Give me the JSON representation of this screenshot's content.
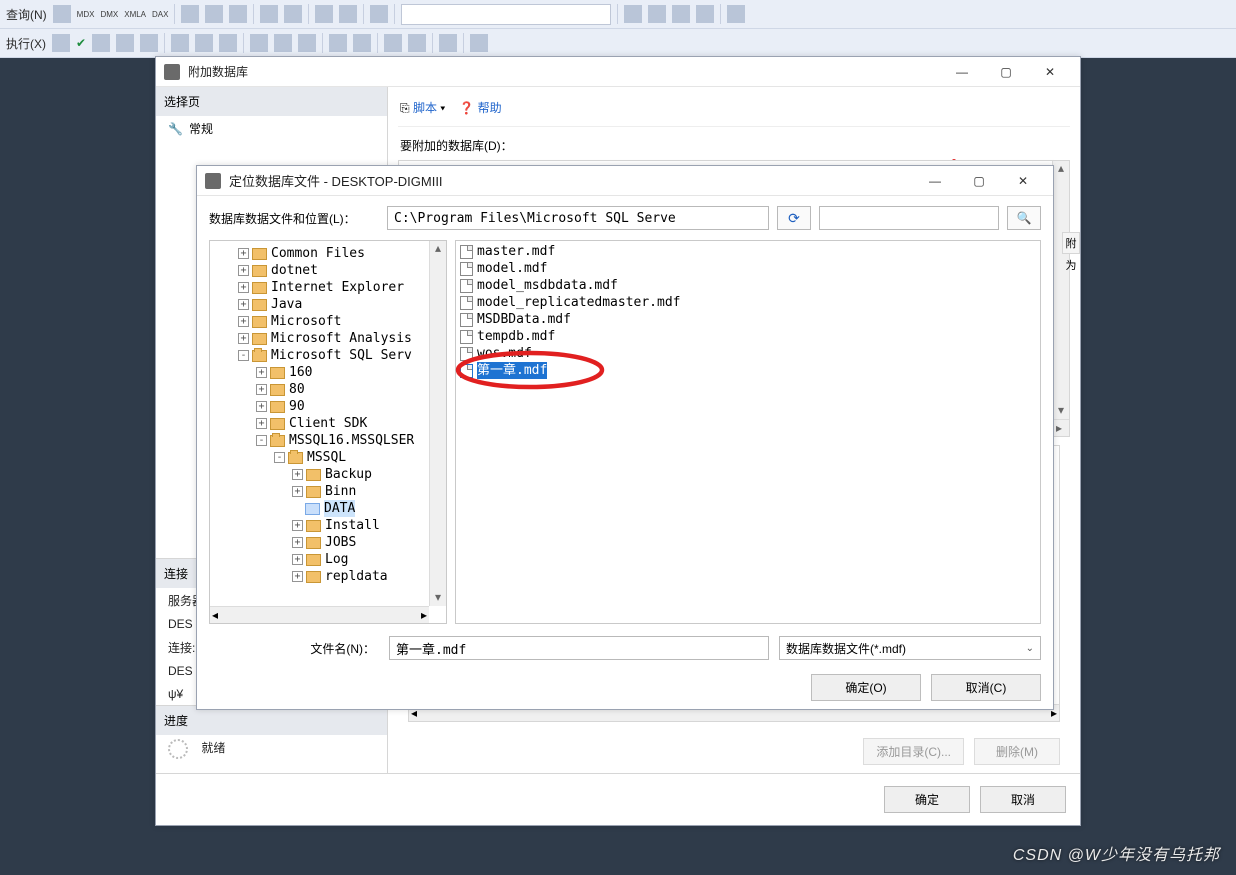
{
  "toolbar": {
    "query_label": "查询(N)",
    "mdx": "MDX",
    "dmx": "DMX",
    "xmla": "XMLA",
    "dax": "DAX",
    "run_label": "执行(X)"
  },
  "attach_dialog": {
    "title": "附加数据库",
    "left": {
      "select_page": "选择页",
      "general": "常规",
      "connection": "连接",
      "server_label": "服务器:",
      "server_value": "DES",
      "conn_label": "连接:",
      "conn_value": "DES",
      "progress": "进度",
      "status": "就绪"
    },
    "right": {
      "script": "脚本",
      "help": "帮助",
      "attach_db_label": "要附加的数据库(D)：",
      "add_dir": "添加目录(C)...",
      "delete_btn": "删除(M)",
      "detail_title_partial": "附为"
    },
    "footer": {
      "ok": "确定",
      "cancel": "取消"
    }
  },
  "locate_dialog": {
    "title": "定位数据库文件 - DESKTOP-DIGMIII",
    "location_label": "数据库数据文件和位置(L)：",
    "path_value": "C:\\Program Files\\Microsoft SQL Serve",
    "filename_label": "文件名(N)：",
    "filename_value": "第一章.mdf",
    "filetype_label": "数据库数据文件(*.mdf)",
    "ok": "确定(O)",
    "cancel": "取消(C)"
  },
  "tree": [
    {
      "indent": 0,
      "toggle": "+",
      "label": "Common Files"
    },
    {
      "indent": 0,
      "toggle": "+",
      "label": "dotnet"
    },
    {
      "indent": 0,
      "toggle": "+",
      "label": "Internet Explorer"
    },
    {
      "indent": 0,
      "toggle": "+",
      "label": "Java"
    },
    {
      "indent": 0,
      "toggle": "+",
      "label": "Microsoft"
    },
    {
      "indent": 0,
      "toggle": "+",
      "label": "Microsoft Analysis"
    },
    {
      "indent": 0,
      "toggle": "-",
      "label": "Microsoft SQL Serv"
    },
    {
      "indent": 1,
      "toggle": "+",
      "label": "160"
    },
    {
      "indent": 1,
      "toggle": "+",
      "label": "80"
    },
    {
      "indent": 1,
      "toggle": "+",
      "label": "90"
    },
    {
      "indent": 1,
      "toggle": "+",
      "label": "Client SDK"
    },
    {
      "indent": 1,
      "toggle": "-",
      "label": "MSSQL16.MSSQLSER"
    },
    {
      "indent": 2,
      "toggle": "-",
      "label": "MSSQL"
    },
    {
      "indent": 3,
      "toggle": "+",
      "label": "Backup"
    },
    {
      "indent": 3,
      "toggle": "+",
      "label": "Binn"
    },
    {
      "indent": 3,
      "toggle": "",
      "label": "DATA",
      "selected": true
    },
    {
      "indent": 3,
      "toggle": "+",
      "label": "Install"
    },
    {
      "indent": 3,
      "toggle": "+",
      "label": "JOBS"
    },
    {
      "indent": 3,
      "toggle": "+",
      "label": "Log"
    },
    {
      "indent": 3,
      "toggle": "+",
      "label": "repldata"
    }
  ],
  "files": [
    {
      "name": "master.mdf"
    },
    {
      "name": "model.mdf"
    },
    {
      "name": "model_msdbdata.mdf"
    },
    {
      "name": "model_replicatedmaster.mdf"
    },
    {
      "name": "MSDBData.mdf"
    },
    {
      "name": "tempdb.mdf"
    },
    {
      "name": "wos.mdf"
    },
    {
      "name": "第一章.mdf",
      "selected": true
    }
  ],
  "watermark": "CSDN @W少年没有乌托邦"
}
